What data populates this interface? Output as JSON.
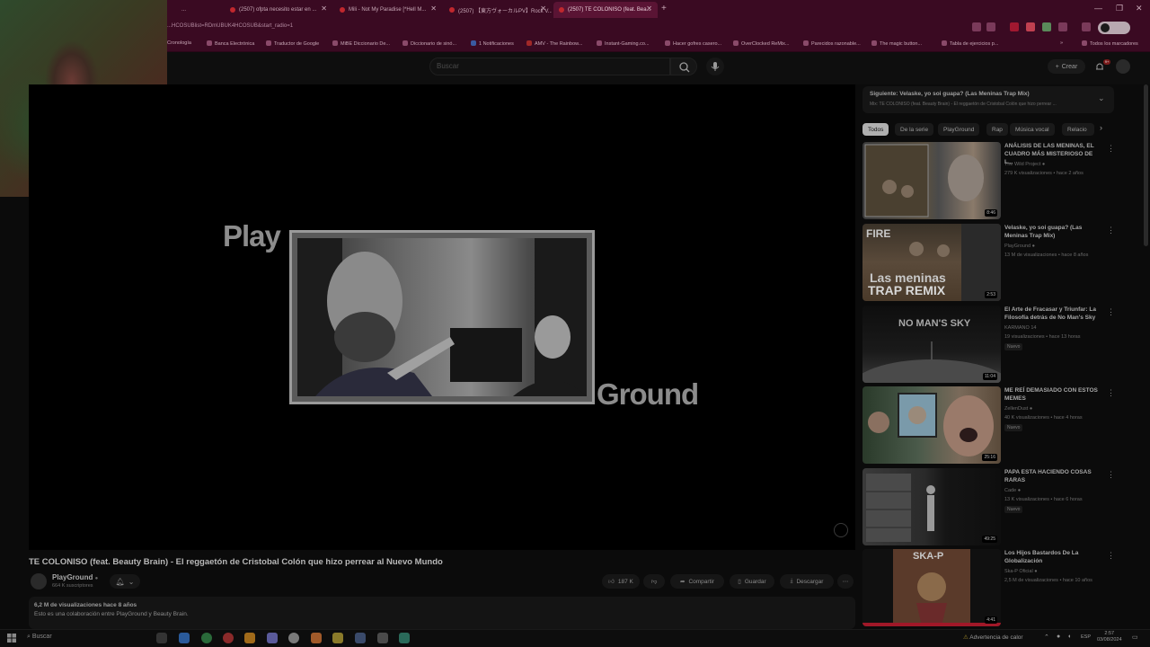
{
  "browser": {
    "tabs": [
      {
        "label": "(2507) ofpta necesito estar en ..."
      },
      {
        "label": "Mili - Not My Paradise [*Hell M..."
      },
      {
        "label": "(2507) 【東方ヴォーカルPV】Rock V..."
      },
      {
        "label": "(2507) TE COLONISO (feat. Bea..."
      }
    ],
    "url": "...HCOSUBlist=RDmUBUK4HCOSUB&start_radio=1",
    "bookmarks": [
      "Cronología",
      "Banca Electrónica",
      "Traductor de Google",
      "MiBE Diccionario De...",
      "Diccionario de sinó...",
      "1 Notificaciones",
      "AMV - The Rainbow...",
      "Instant-Gaming.co...",
      "Hacer gofres casero...",
      "OverClocked ReMix...",
      "Parecidos razonable...",
      "The magic button...",
      "Tabla de ejercicios p...",
      "Todos los marcadores"
    ]
  },
  "header": {
    "search_placeholder": "Buscar",
    "create_label": "Crear",
    "notif_count": "9+"
  },
  "player": {
    "overlay_left": "Play",
    "overlay_right": "Ground"
  },
  "video": {
    "title": "TE COLONISO (feat. Beauty Brain) - El reggaetón de Cristobal Colón que hizo perrear al Nuevo Mundo",
    "channel": "PlayGround",
    "subscribers": "664 K suscriptores",
    "likes": "187 K",
    "share": "Compartir",
    "save": "Guardar",
    "download": "Descargar",
    "views_line": "6,2 M de visualizaciones  hace 8 años",
    "description": "Esto es una colaboración entre PlayGround y Beauty Brain."
  },
  "upnext": {
    "title": "Siguiente: Velaske, yo soi guapa? (Las Meninas Trap Mix)",
    "subtitle": "Mix: TE COLONISO (feat. Beauty Brain) - El reggaetón de Cristobal Colón que hizo perrear ..."
  },
  "chips": [
    "Todos",
    "De la serie",
    "PlayGround",
    "Rap",
    "Música vocal",
    "Relacio"
  ],
  "recommendations": [
    {
      "title": "ANÁLISIS DE LAS MENINAS, EL CUADRO MÁS MISTERIOSO DE L...",
      "channel": "The Wild Project",
      "meta": "279 K visualizaciones • hace 2 años",
      "duration": "8:46",
      "new": ""
    },
    {
      "title": "Velaske, yo soi guapa? (Las Meninas Trap Mix)",
      "channel": "PlayGround",
      "meta": "13 M de visualizaciones • hace 8 años",
      "duration": "2:53",
      "new": ""
    },
    {
      "title": "El Arte de Fracasar y Triunfar: La Filosofía detrás de No Man's Sky",
      "channel": "KARMANO 14",
      "meta": "19 visualizaciones • hace 13 horas",
      "duration": "11:04",
      "new": "Nuevo"
    },
    {
      "title": "ME REÍ DEMASIADO CON ESTOS MEMES",
      "channel": "ZellenDust",
      "meta": "40 K visualizaciones • hace 4 horas",
      "duration": "25:16",
      "new": "Nuevo"
    },
    {
      "title": "PAPA ESTA HACIENDO COSAS RARAS",
      "channel": "Cade",
      "meta": "13 K visualizaciones • hace 6 horas",
      "duration": "49:25",
      "new": "Nuevo"
    },
    {
      "title": "Los Hijos Bastardos De La Globalización",
      "channel": "Ska-P Oficial",
      "meta": "2,5 M de visualizaciones • hace 10 años",
      "duration": "4:41",
      "new": ""
    }
  ],
  "thumb_texts": {
    "fire": "FIRE",
    "meninas": "Las meninas",
    "trap": "TRAP REMIX",
    "nomans": "NO MAN'S SKY",
    "skap": "SKA-P"
  },
  "taskbar": {
    "search": "Buscar",
    "warning": "Advertencia de calor",
    "lang": "ESP",
    "time": "2:57",
    "date": "03/08/2024"
  }
}
